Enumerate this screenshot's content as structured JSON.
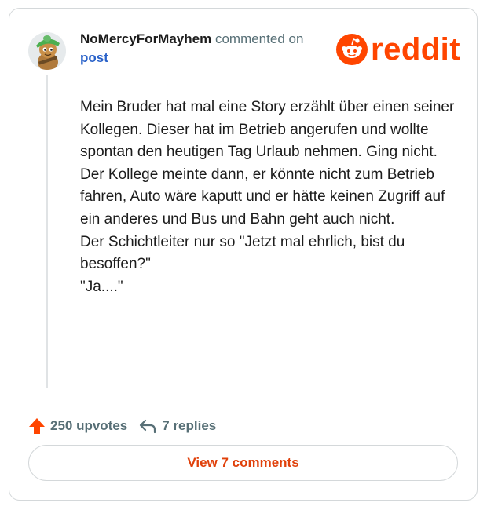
{
  "comment": {
    "username": "NoMercyForMayhem",
    "action_text": "commented on",
    "post_link": "post",
    "body_lines": [
      "Mein Bruder hat mal eine Story erzählt über einen seiner Kollegen. Dieser hat im Betrieb angerufen und wollte spontan den heutigen Tag Urlaub nehmen. Ging nicht.",
      "Der Kollege meinte dann, er könnte nicht zum Betrieb fahren, Auto wäre kaputt und er hätte keinen Zugriff auf ein anderes und Bus und Bahn geht auch nicht.",
      "Der Schichtleiter nur so \"Jetzt mal ehrlich, bist du besoffen?\"",
      "\"Ja....\""
    ]
  },
  "brand": {
    "logo_text": "reddit",
    "color": "#ff4500"
  },
  "stats": {
    "upvotes": "250 upvotes",
    "upvote_icon": "upvote-arrow-icon",
    "replies": "7 replies",
    "reply_icon": "reply-arrow-icon"
  },
  "view_button": {
    "label": "View 7 comments"
  },
  "colors": {
    "link": "#2a62c9",
    "muted": "#576f76",
    "accent": "#ff4500"
  }
}
